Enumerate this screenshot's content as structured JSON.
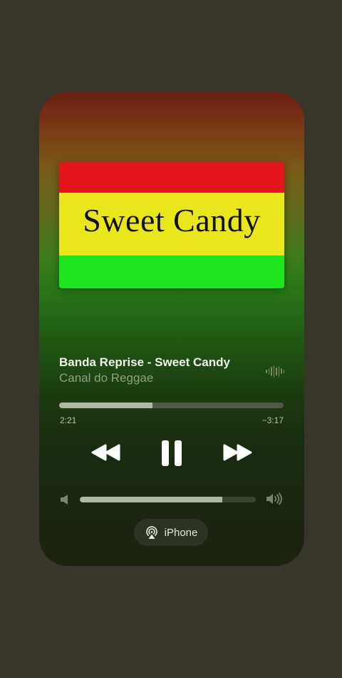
{
  "album_art": {
    "text": "Sweet Candy",
    "colors": {
      "top": "#e3151b",
      "middle": "#e9e61c",
      "bottom": "#1de51f"
    }
  },
  "track": {
    "title": "Banda Reprise - Sweet Candy",
    "artist": "Canal do Reggae"
  },
  "playback": {
    "elapsed": "2:21",
    "remaining": "−3:17",
    "progress_fraction": 0.417,
    "state": "playing"
  },
  "controls": {
    "rewind_icon": "backward-icon",
    "pause_icon": "pause-icon",
    "forward_icon": "forward-icon"
  },
  "volume": {
    "level_fraction": 0.81
  },
  "output": {
    "device_label": "iPhone",
    "icon": "airplay-audio-icon"
  },
  "theme": {
    "page_bg": "#38362a",
    "text_primary": "#f2f2ee",
    "text_secondary": "#8fa07a"
  }
}
